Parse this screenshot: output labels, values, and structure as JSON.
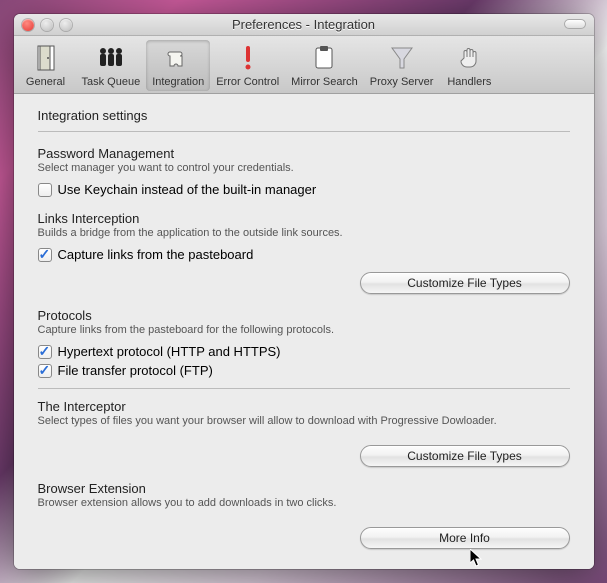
{
  "window": {
    "title": "Preferences - Integration"
  },
  "toolbar": {
    "items": [
      {
        "label": "General"
      },
      {
        "label": "Task Queue"
      },
      {
        "label": "Integration"
      },
      {
        "label": "Error Control"
      },
      {
        "label": "Mirror Search"
      },
      {
        "label": "Proxy Server"
      },
      {
        "label": "Handlers"
      }
    ]
  },
  "page_heading": "Integration settings",
  "password": {
    "title": "Password Management",
    "desc": "Select manager you want to control your credentials.",
    "checkbox_label": "Use Keychain instead of the built-in manager",
    "checked": false
  },
  "links": {
    "title": "Links Interception",
    "desc": "Builds a bridge from the application to the outside link sources.",
    "checkbox_label": "Capture links from the pasteboard",
    "checked": true,
    "button": "Customize File Types"
  },
  "protocols": {
    "title": "Protocols",
    "desc": "Capture links from the pasteboard for the following protocols.",
    "http_label": "Hypertext protocol (HTTP and HTTPS)",
    "http_checked": true,
    "ftp_label": "File transfer protocol (FTP)",
    "ftp_checked": true
  },
  "interceptor": {
    "title": "The Interceptor",
    "desc": "Select types of files you want your browser will allow to download with Progressive Dowloader.",
    "button": "Customize File Types"
  },
  "extension": {
    "title": "Browser Extension",
    "desc": "Browser extension allows you to add downloads in two clicks.",
    "button": "More Info"
  }
}
